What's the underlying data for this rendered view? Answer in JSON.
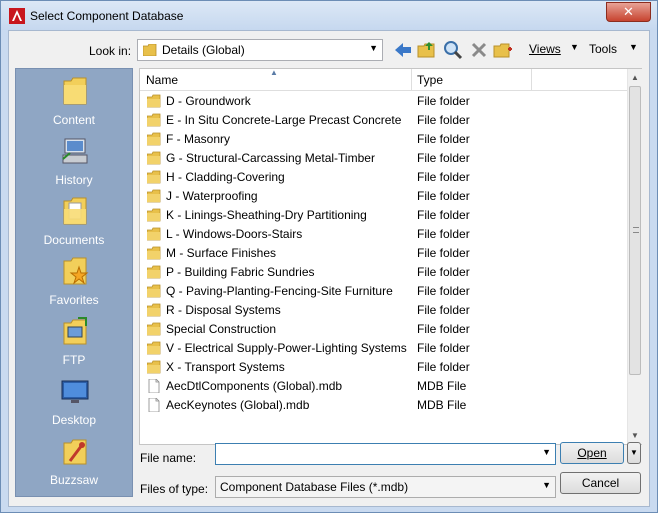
{
  "window": {
    "title": "Select Component Database",
    "close_glyph": "✕"
  },
  "toolbar": {
    "look_in_label": "Look in:",
    "look_in_value": "Details (Global)",
    "icons": [
      "back-icon",
      "up-folder-icon",
      "search-web-icon",
      "delete-icon",
      "new-folder-icon"
    ],
    "views_label": "Views",
    "tools_label": "Tools"
  },
  "places": [
    {
      "label": "Content",
      "icon": "content-folder-icon"
    },
    {
      "label": "History",
      "icon": "history-icon"
    },
    {
      "label": "Documents",
      "icon": "documents-icon"
    },
    {
      "label": "Favorites",
      "icon": "favorites-icon"
    },
    {
      "label": "FTP",
      "icon": "ftp-icon"
    },
    {
      "label": "Desktop",
      "icon": "desktop-icon"
    },
    {
      "label": "Buzzsaw",
      "icon": "buzzsaw-icon"
    }
  ],
  "list": {
    "columns": {
      "name": "Name",
      "type": "Type"
    },
    "rows": [
      {
        "name": "D - Groundwork",
        "type": "File folder",
        "kind": "folder"
      },
      {
        "name": "E - In Situ Concrete-Large Precast Concrete",
        "type": "File folder",
        "kind": "folder"
      },
      {
        "name": "F - Masonry",
        "type": "File folder",
        "kind": "folder"
      },
      {
        "name": "G - Structural-Carcassing Metal-Timber",
        "type": "File folder",
        "kind": "folder"
      },
      {
        "name": "H - Cladding-Covering",
        "type": "File folder",
        "kind": "folder"
      },
      {
        "name": "J - Waterproofing",
        "type": "File folder",
        "kind": "folder"
      },
      {
        "name": "K - Linings-Sheathing-Dry Partitioning",
        "type": "File folder",
        "kind": "folder"
      },
      {
        "name": "L - Windows-Doors-Stairs",
        "type": "File folder",
        "kind": "folder"
      },
      {
        "name": "M - Surface Finishes",
        "type": "File folder",
        "kind": "folder"
      },
      {
        "name": "P - Building Fabric Sundries",
        "type": "File folder",
        "kind": "folder"
      },
      {
        "name": "Q - Paving-Planting-Fencing-Site Furniture",
        "type": "File folder",
        "kind": "folder"
      },
      {
        "name": "R - Disposal Systems",
        "type": "File folder",
        "kind": "folder"
      },
      {
        "name": "Special Construction",
        "type": "File folder",
        "kind": "folder"
      },
      {
        "name": "V - Electrical Supply-Power-Lighting Systems",
        "type": "File folder",
        "kind": "folder"
      },
      {
        "name": "X - Transport Systems",
        "type": "File folder",
        "kind": "folder"
      },
      {
        "name": "AecDtlComponents (Global).mdb",
        "type": "MDB File",
        "kind": "file"
      },
      {
        "name": "AecKeynotes (Global).mdb",
        "type": "MDB File",
        "kind": "file"
      }
    ]
  },
  "bottom": {
    "file_name_label": "File name:",
    "file_name_value": "",
    "files_of_type_label": "Files of type:",
    "files_of_type_value": "Component Database Files (*.mdb)",
    "open_label": "Open",
    "cancel_label": "Cancel"
  },
  "colors": {
    "places_bg": "#8fa6c4",
    "folder": "#e8c04a",
    "titlebar": "#c6d8ef"
  }
}
